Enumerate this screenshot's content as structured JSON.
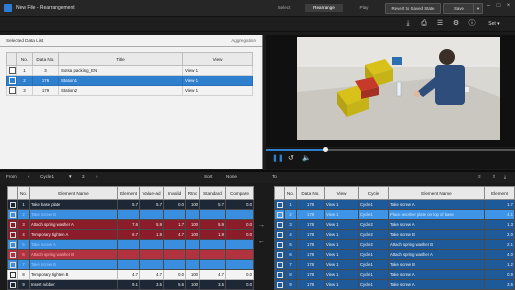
{
  "window": {
    "title": "New File - Rearrangement"
  },
  "tabs": [
    "Select",
    "Rearrange",
    "Play"
  ],
  "buttons": {
    "revert": "Revert to Saved State",
    "save": "Save"
  },
  "data_list": {
    "title": "Selected Data List",
    "aggregation": "Aggregation",
    "columns": [
      "",
      "No.",
      "Data No.",
      "Title",
      "View"
    ],
    "rows": [
      {
        "no": "1",
        "data_no": "3",
        "title": "Sotsa packing_EN",
        "view": "View 1"
      },
      {
        "no": "2",
        "data_no": "176",
        "title": "Station1",
        "view": "View 1"
      },
      {
        "no": "3",
        "data_no": "179",
        "title": "Station2",
        "view": "View 1"
      }
    ]
  },
  "sequence_bar": {
    "from": "From",
    "cycle": "Cycle1",
    "page": "3",
    "sort": "Sort",
    "none": "None"
  },
  "to_bar": {
    "to": "To"
  },
  "left_table": {
    "columns": [
      "",
      "No.",
      "Element Name",
      "Element",
      "Value-ad",
      "Invalid",
      "Rtnc",
      "Standard",
      "Compare"
    ],
    "rows": [
      {
        "no": "1",
        "name": "Take base plate",
        "e": "5.7",
        "v": "5.7",
        "i": "0.0",
        "r": "100",
        "s": "5.7",
        "c": "0.0"
      },
      {
        "no": "2",
        "name": "Take screw B",
        "e": "",
        "v": "",
        "i": "",
        "r": "",
        "s": "",
        "c": ""
      },
      {
        "no": "3",
        "name": "Attach spring washer A",
        "e": "7.6",
        "v": "5.9",
        "i": "1.7",
        "r": "100",
        "s": "5.9",
        "c": "0.0"
      },
      {
        "no": "4",
        "name": "Temporary tighten A",
        "e": "6.7",
        "v": "1.9",
        "i": "4.7",
        "r": "100",
        "s": "1.9",
        "c": "0.0"
      },
      {
        "no": "5",
        "name": "Take screw A",
        "e": "",
        "v": "",
        "i": "",
        "r": "",
        "s": "",
        "c": ""
      },
      {
        "no": "6",
        "name": "Attach spring washer B",
        "e": "",
        "v": "",
        "i": "",
        "r": "",
        "s": "",
        "c": ""
      },
      {
        "no": "7",
        "name": "Take screw B",
        "e": "",
        "v": "",
        "i": "",
        "r": "",
        "s": "",
        "c": ""
      },
      {
        "no": "8",
        "name": "Temporary tighten B",
        "e": "4.7",
        "v": "4.7",
        "i": "0.0",
        "r": "100",
        "s": "4.7",
        "c": "0.0"
      },
      {
        "no": "9",
        "name": "Insert rubber",
        "e": "9.1",
        "v": "3.5",
        "i": "5.6",
        "r": "100",
        "s": "3.5",
        "c": "0.0"
      }
    ]
  },
  "right_table": {
    "columns": [
      "",
      "No.",
      "Data No.",
      "View",
      "Cycle",
      "Element Name",
      "Element"
    ],
    "rows": [
      {
        "no": "1",
        "data_no": "178",
        "view": "View 1",
        "cycle": "Cycle1",
        "name": "Take screw A",
        "e": "1.7"
      },
      {
        "no": "2",
        "data_no": "178",
        "view": "View 1",
        "cycle": "Cycle1",
        "name": "Place another plate on top of base",
        "e": "4.1"
      },
      {
        "no": "3",
        "data_no": "178",
        "view": "View 1",
        "cycle": "Cycle2",
        "name": "Take screw A",
        "e": "1.3"
      },
      {
        "no": "4",
        "data_no": "178",
        "view": "View 1",
        "cycle": "Cycle2",
        "name": "Take screw B",
        "e": "2.0"
      },
      {
        "no": "5",
        "data_no": "178",
        "view": "View 1",
        "cycle": "Cycle2",
        "name": "Attach spring washer B",
        "e": "2.1"
      },
      {
        "no": "6",
        "data_no": "178",
        "view": "View 1",
        "cycle": "Cycle1",
        "name": "Attach spring washer A",
        "e": "4.0"
      },
      {
        "no": "7",
        "data_no": "178",
        "view": "View 1",
        "cycle": "Cycle1",
        "name": "Take screw B",
        "e": "1.2"
      },
      {
        "no": "8",
        "data_no": "178",
        "view": "View 1",
        "cycle": "Cycle1",
        "name": "Take screw A",
        "e": "0.9"
      },
      {
        "no": "9",
        "data_no": "178",
        "view": "View 1",
        "cycle": "Cycle1",
        "name": "Take screw A",
        "e": "3.5"
      }
    ]
  },
  "colors": {
    "accent": "#2f7fcf",
    "non_value_row": "#8b1d2a",
    "selected_row": "#3e95e8"
  },
  "icons": {
    "toolbar": [
      "download-icon",
      "print-icon",
      "list-icon",
      "gear-icon",
      "info-icon",
      "settings-dropdown-icon"
    ],
    "player": [
      "pause-icon",
      "rewind-icon",
      "volume-icon"
    ]
  },
  "settings_label": "Set"
}
